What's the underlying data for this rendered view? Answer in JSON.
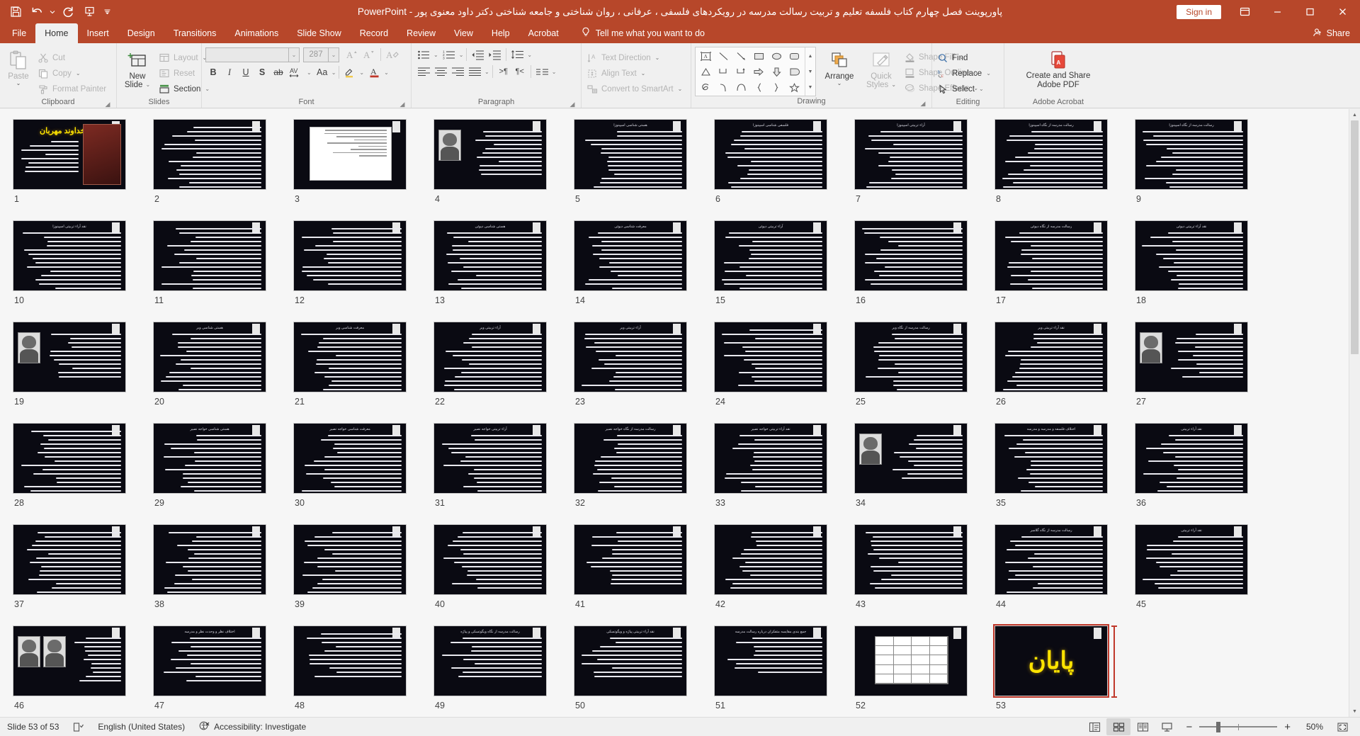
{
  "titlebar": {
    "document_title": "پاورپوینت فصل چهارم کتاب فلسفه تعلیم و تربیت رسالت مدرسه در رویکردهای فلسفی ، عرفانی ، روان شناختی و جامعه شناختی دکتر داود معنوی پور",
    "app_name": "PowerPoint",
    "separator": "-",
    "signin_label": "Sign in",
    "qat": [
      {
        "name": "save-icon",
        "label": "Save"
      },
      {
        "name": "undo-icon",
        "label": "Undo"
      },
      {
        "name": "undo-dropdown-icon",
        "label": "Undo options"
      },
      {
        "name": "redo-icon",
        "label": "Redo"
      },
      {
        "name": "start-presentation-icon",
        "label": "Start From Beginning"
      },
      {
        "name": "customize-qat-icon",
        "label": "Customize Quick Access Toolbar"
      }
    ],
    "window_controls": [
      {
        "name": "ribbon-display-options-icon",
        "label": "Ribbon Display Options"
      },
      {
        "name": "minimize-icon",
        "label": "Minimize"
      },
      {
        "name": "maximize-icon",
        "label": "Restore Down"
      },
      {
        "name": "close-icon",
        "label": "Close"
      }
    ]
  },
  "tabs": [
    {
      "label": "File",
      "active": false
    },
    {
      "label": "Home",
      "active": true
    },
    {
      "label": "Insert",
      "active": false
    },
    {
      "label": "Design",
      "active": false
    },
    {
      "label": "Transitions",
      "active": false
    },
    {
      "label": "Animations",
      "active": false
    },
    {
      "label": "Slide Show",
      "active": false
    },
    {
      "label": "Record",
      "active": false
    },
    {
      "label": "Review",
      "active": false
    },
    {
      "label": "View",
      "active": false
    },
    {
      "label": "Help",
      "active": false
    },
    {
      "label": "Acrobat",
      "active": false
    }
  ],
  "tellme": {
    "label": "Tell me what you want to do",
    "icon": "lightbulb-icon"
  },
  "share": {
    "label": "Share",
    "icon": "share-person-icon"
  },
  "ribbon": {
    "clipboard": {
      "label": "Clipboard",
      "paste": "Paste",
      "cut": "Cut",
      "copy": "Copy",
      "format_painter": "Format Painter"
    },
    "slides": {
      "label": "Slides",
      "new_slide": "New\nSlide",
      "new_slide_line1": "New",
      "new_slide_line2": "Slide",
      "layout": "Layout",
      "reset": "Reset",
      "section": "Section"
    },
    "font": {
      "label": "Font",
      "font_name": "",
      "font_size": "287",
      "buttons": [
        {
          "name": "bold-button",
          "glyph": "B"
        },
        {
          "name": "italic-button",
          "glyph": "I"
        },
        {
          "name": "underline-button",
          "glyph": "U"
        },
        {
          "name": "text-shadow-button",
          "glyph": "S"
        },
        {
          "name": "strikethrough-button",
          "glyph": "ab"
        },
        {
          "name": "character-spacing-button",
          "glyph": "AV"
        },
        {
          "name": "change-case-button",
          "glyph": "Aa"
        },
        {
          "name": "increase-font-size-button",
          "glyph": "A"
        },
        {
          "name": "decrease-font-size-button",
          "glyph": "A"
        },
        {
          "name": "clear-formatting-button",
          "glyph": "A"
        },
        {
          "name": "text-highlight-color-button",
          "glyph": ""
        },
        {
          "name": "font-color-button",
          "glyph": "A"
        }
      ]
    },
    "paragraph": {
      "label": "Paragraph",
      "text_direction": "Text Direction",
      "align_text": "Align Text",
      "convert_to_smartart": "Convert to SmartArt"
    },
    "drawing": {
      "label": "Drawing",
      "arrange": "Arrange",
      "quick_styles_line1": "Quick",
      "quick_styles_line2": "Styles",
      "shape_fill": "Shape Fill",
      "shape_outline": "Shape Outline",
      "shape_effects": "Shape Effects"
    },
    "editing": {
      "label": "Editing",
      "find": "Find",
      "replace": "Replace",
      "select": "Select"
    },
    "acrobat": {
      "label": "Adobe Acrobat",
      "create_share_line1": "Create and Share",
      "create_share_line2": "Adobe PDF"
    }
  },
  "slides": [
    {
      "n": "1",
      "type": "cover",
      "title": "بنام خداوند مهربان"
    },
    {
      "n": "2",
      "type": "text",
      "title": "",
      "lines": 16
    },
    {
      "n": "3",
      "type": "document",
      "title": ""
    },
    {
      "n": "4",
      "type": "photo",
      "title": ""
    },
    {
      "n": "5",
      "type": "text",
      "title": "هستی شناسی اسپینوزا",
      "lines": 14
    },
    {
      "n": "6",
      "type": "text",
      "title": "فلسفی شناسی اسپینوزا",
      "lines": 15
    },
    {
      "n": "7",
      "type": "text",
      "title": "آراء تربیتی اسپینوزا",
      "lines": 14
    },
    {
      "n": "8",
      "type": "text",
      "title": "رسالت مدرسه از نگاه اسپینوزا",
      "lines": 15
    },
    {
      "n": "9",
      "type": "text",
      "title": "رسالت مدرسه از نگاه اسپینوزا",
      "lines": 14
    },
    {
      "n": "10",
      "type": "text",
      "title": "نقد آراء تربیتی اسپینوزا",
      "lines": 15
    },
    {
      "n": "11",
      "type": "text",
      "title": "",
      "lines": 15
    },
    {
      "n": "12",
      "type": "text",
      "title": "",
      "lines": 14
    },
    {
      "n": "13",
      "type": "text",
      "title": "هستی شناسی دیوئی",
      "lines": 15
    },
    {
      "n": "14",
      "type": "text",
      "title": "معرفت شناسی دیوئی",
      "lines": 14
    },
    {
      "n": "15",
      "type": "text",
      "title": "آراء تربیتی دیوئی",
      "lines": 15
    },
    {
      "n": "16",
      "type": "text",
      "title": "",
      "lines": 14
    },
    {
      "n": "17",
      "type": "text",
      "title": "رسالت مدرسه از نگاه دیوئی",
      "lines": 15
    },
    {
      "n": "18",
      "type": "text",
      "title": "نقد آراء تربیتی دیوئی",
      "lines": 14
    },
    {
      "n": "19",
      "type": "photo",
      "title": ""
    },
    {
      "n": "20",
      "type": "text",
      "title": "هستی شناسی وبر",
      "lines": 15
    },
    {
      "n": "21",
      "type": "text",
      "title": "معرفت شناسی وبر",
      "lines": 14
    },
    {
      "n": "22",
      "type": "text",
      "title": "آراء تربیتی وبر",
      "lines": 14
    },
    {
      "n": "23",
      "type": "text",
      "title": "آراء تربیتی وبر",
      "lines": 15
    },
    {
      "n": "24",
      "type": "text",
      "title": "",
      "lines": 14
    },
    {
      "n": "25",
      "type": "text",
      "title": "رسالت مدرسه از نگاه وبر",
      "lines": 15
    },
    {
      "n": "26",
      "type": "text",
      "title": "نقد آراء تربیتی وبر",
      "lines": 14
    },
    {
      "n": "27",
      "type": "photo",
      "title": ""
    },
    {
      "n": "28",
      "type": "text",
      "title": "",
      "lines": 15
    },
    {
      "n": "29",
      "type": "text",
      "title": "هستی شناسی خواجه نصیر",
      "lines": 14
    },
    {
      "n": "30",
      "type": "text",
      "title": "معرفت شناسی خواجه نصیر",
      "lines": 15
    },
    {
      "n": "31",
      "type": "text",
      "title": "آراء تربیتی خواجه نصیر",
      "lines": 14
    },
    {
      "n": "32",
      "type": "text",
      "title": "رسالت مدرسه از نگاه خواجه نصیر",
      "lines": 15
    },
    {
      "n": "33",
      "type": "text",
      "title": "نقد آراء تربیتی خواجه نصیر",
      "lines": 14
    },
    {
      "n": "34",
      "type": "photo",
      "title": ""
    },
    {
      "n": "35",
      "type": "text",
      "title": "اختلاف فلسفه و مدرسه و مدرسه",
      "lines": 14
    },
    {
      "n": "36",
      "type": "text",
      "title": "نقد آراء تربیتی",
      "lines": 15
    },
    {
      "n": "37",
      "type": "text",
      "title": "",
      "lines": 15
    },
    {
      "n": "38",
      "type": "text",
      "title": "",
      "lines": 15
    },
    {
      "n": "39",
      "type": "text",
      "title": "",
      "lines": 15
    },
    {
      "n": "40",
      "type": "text",
      "title": "",
      "lines": 14
    },
    {
      "n": "41",
      "type": "text",
      "title": "",
      "lines": 13
    },
    {
      "n": "42",
      "type": "text",
      "title": "",
      "lines": 14
    },
    {
      "n": "43",
      "type": "text",
      "title": "",
      "lines": 14
    },
    {
      "n": "44",
      "type": "text",
      "title": "رسالت مدرسه از نگاه گلاسر",
      "lines": 14
    },
    {
      "n": "45",
      "type": "text",
      "title": "نقد آراء تربیتی",
      "lines": 13
    },
    {
      "n": "46",
      "type": "photo2",
      "title": ""
    },
    {
      "n": "47",
      "type": "text",
      "title": "اختلاف نظر و وحدت نظر و مدرسه",
      "lines": 11
    },
    {
      "n": "48",
      "type": "text",
      "title": "",
      "lines": 11
    },
    {
      "n": "49",
      "type": "text",
      "title": "رسالت مدرسه از نگاه ویگوتسکی و پیاژه",
      "lines": 10
    },
    {
      "n": "50",
      "type": "text",
      "title": "نقد آراء تربیتی پیاژه و ویگوتسکی",
      "lines": 10
    },
    {
      "n": "51",
      "type": "text",
      "title": "جمع بندی مقایسه متفکران درباره رسالت مدرسه",
      "lines": 9
    },
    {
      "n": "52",
      "type": "table",
      "title": ""
    },
    {
      "n": "53",
      "type": "end",
      "title": "پایان",
      "selected": true
    }
  ],
  "statusbar": {
    "slide_counter": "Slide 53 of 53",
    "language": "English (United States)",
    "accessibility": "Accessibility: Investigate",
    "views": [
      {
        "name": "normal-view-button",
        "label": "Normal",
        "active": false
      },
      {
        "name": "slide-sorter-view-button",
        "label": "Slide Sorter",
        "active": true
      },
      {
        "name": "reading-view-button",
        "label": "Reading View",
        "active": false
      },
      {
        "name": "slide-show-button",
        "label": "Slide Show",
        "active": false
      }
    ],
    "zoom_percent": "50%",
    "zoom_out_label": "−",
    "zoom_in_label": "+",
    "fit_label": "Fit slide to current window"
  },
  "colors": {
    "accent": "#b7472a",
    "ribbon_bg": "#f0f0f0",
    "selection": "#c0392b",
    "end_text": "#ffe400"
  }
}
